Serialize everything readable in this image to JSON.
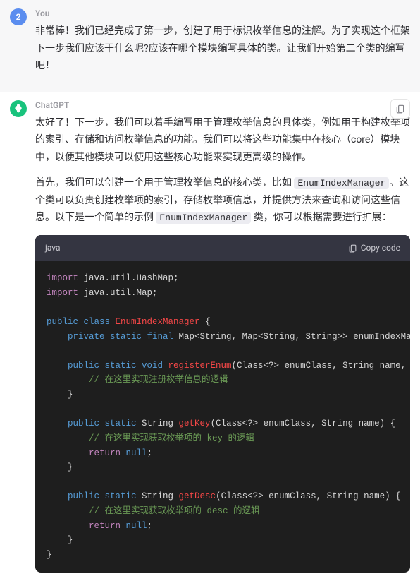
{
  "user": {
    "sender": "You",
    "avatar_text": "2",
    "message": "非常棒！我们已经完成了第一步，创建了用于标识枚举信息的注解。为了实现这个框架下一步我们应该干什么呢?应该在哪个模块编写具体的类。让我们开始第二个类的编写吧！"
  },
  "assistant": {
    "sender": "ChatGPT",
    "p1_a": "太好了！下一步，我们可以着手编写用于管理枚举信息的具体类，例如用于构建枚举项的索引、存储和访问枚举信息的功能。我们可以将这些功能集中在核心（core）模块中，以便其他模块可以使用这些核心功能来实现更高级的操作。",
    "p2_a": "首先，我们可以创建一个用于管理枚举信息的核心类，比如 ",
    "p2_code1": "EnumIndexManager",
    "p2_b": "。这个类可以负责创建枚举项的索引，存储枚举项信息，并提供方法来查询和访问这些信息。以下是一个简单的示例 ",
    "p2_code2": "EnumIndexManager",
    "p2_c": " 类，你可以根据需要进行扩展：",
    "code_lang": "java",
    "copy_label": "Copy code",
    "code": {
      "l1_kw": "import",
      "l1_pkg": " java.util.HashMap;",
      "l2_kw": "import",
      "l2_pkg": " java.util.Map;",
      "l4_mod": "public class ",
      "l4_cls": "EnumIndexManager",
      "l4_rest": " {",
      "l5_mod": "    private static final",
      "l5_rest": " Map<String, Map<String, String>> enumIndexMap = ",
      "l7_mod": "    public static void ",
      "l7_fn": "registerEnum",
      "l7_rest": "(Class<?> enumClass, String name, Stri",
      "l8_cmt": "        // 在这里实现注册枚举信息的逻辑",
      "l9": "    }",
      "l11_mod": "    public static",
      "l11_type": " String ",
      "l11_fn": "getKey",
      "l11_rest": "(Class<?> enumClass, String name) {",
      "l12_cmt": "        // 在这里实现获取枚举项的 key 的逻辑",
      "l13_kw": "        return ",
      "l13_lit": "null",
      "l13_end": ";",
      "l14": "    }",
      "l16_mod": "    public static",
      "l16_type": " String ",
      "l16_fn": "getDesc",
      "l16_rest": "(Class<?> enumClass, String name) {",
      "l17_cmt": "        // 在这里实现获取枚举项的 desc 的逻辑",
      "l18_kw": "        return ",
      "l18_lit": "null",
      "l18_end": ";",
      "l19": "    }",
      "l20": "}"
    }
  }
}
